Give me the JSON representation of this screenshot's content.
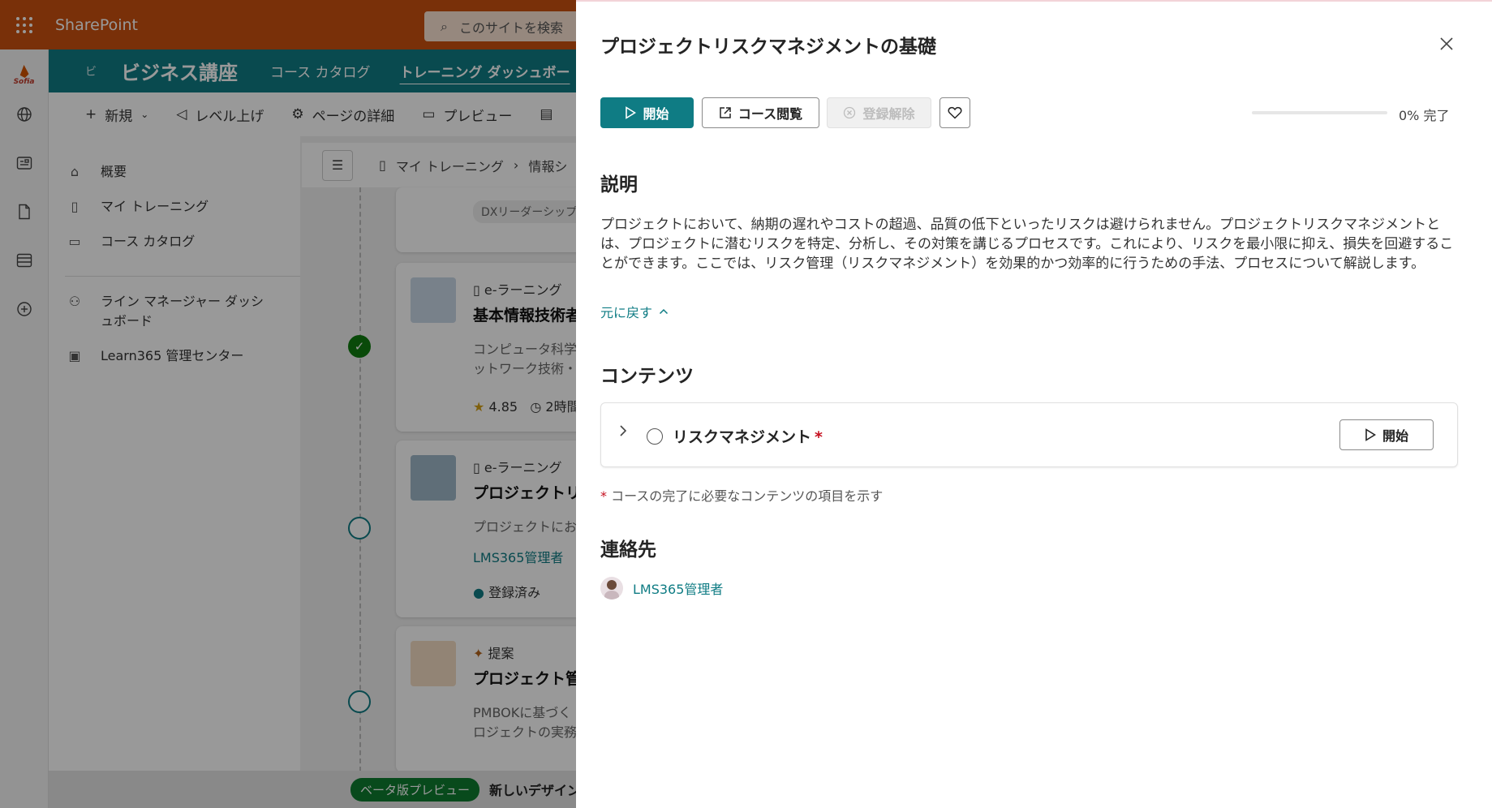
{
  "suite": {
    "brand": "SharePoint",
    "search_placeholder": "このサイトを検索"
  },
  "rail": {
    "logo_text": "Sofia"
  },
  "site": {
    "back_label": "ビ",
    "title": "ビジネス講座",
    "nav": [
      "コース カタログ",
      "トレーニング ダッシュボー"
    ]
  },
  "commands": [
    "新規",
    "レベル上げ",
    "ページの詳細",
    "プレビュー"
  ],
  "leftnav": {
    "items": [
      "概要",
      "マイ トレーニング",
      "コース カタログ"
    ],
    "manager": [
      "ライン マネージャー ダッシ",
      "ュボード"
    ],
    "admin": "Learn365 管理センター"
  },
  "breadcrumb": {
    "items": [
      "マイ トレーニング",
      "情報シ"
    ]
  },
  "cards": {
    "tag": "DXリーダーシップ",
    "c1": {
      "type": "e-ラーニング",
      "title": "基本情報技術者",
      "desc1": "コンピュータ科学",
      "desc2": "ットワーク技術・",
      "rating": "4.85",
      "duration": "2時間"
    },
    "c2": {
      "type": "e-ラーニング",
      "title": "プロジェクトリ",
      "desc1": "プロジェクトにお",
      "author": "LMS365管理者",
      "status": "登録済み"
    },
    "c3": {
      "type": "提案",
      "title": "プロジェクト管",
      "desc1": "PMBOKに基づく",
      "desc2": "ロジェクトの実務"
    }
  },
  "beta": {
    "pill": "ベータ版プレビュー",
    "text": "新しいデザイン"
  },
  "panel": {
    "title": "プロジェクトリスクマネジメントの基礎",
    "buttons": {
      "start": "開始",
      "browse": "コース閲覧",
      "unenroll": "登録解除"
    },
    "progress": {
      "value": 0,
      "label": "0% 完了"
    },
    "description_heading": "説明",
    "description": "プロジェクトにおいて、納期の遅れやコストの超過、品質の低下といったリスクは避けられません。プロジェクトリスクマネジメントとは、プロジェクトに潜むリスクを特定、分析し、その対策を講じるプロセスです。これにより、リスクを最小限に抑え、損失を回避することができます。ここでは、リスク管理（リスクマネジメント）を効果的かつ効率的に行うための手法、プロセスについて解説します。",
    "collapse_link": "元に戻す",
    "contents_heading": "コンテンツ",
    "content_item": {
      "name": "リスクマネジメント",
      "required_mark": "*",
      "start": "開始"
    },
    "required_note_mark": "*",
    "required_note": "コースの完了に必要なコンテンツの項目を示す",
    "contact_heading": "連絡先",
    "contact_name": "LMS365管理者"
  },
  "colors": {
    "accent": "#0f7c84",
    "suitebar": "#ca5010",
    "required": "#c50f1f"
  }
}
